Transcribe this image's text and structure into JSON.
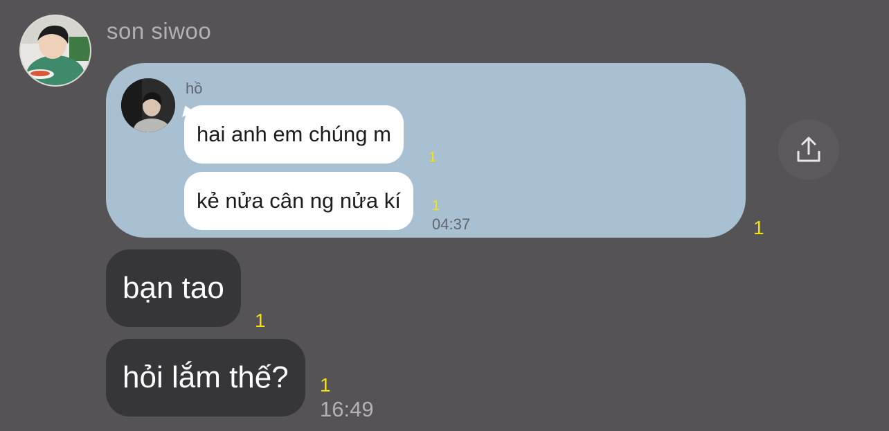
{
  "conversation": {
    "sender_name": "son siwoo",
    "shared_message": {
      "author_name": "hồ",
      "lines": [
        {
          "text": "hai anh em chúng m",
          "unread": "1"
        },
        {
          "text": "kẻ nửa cân ng nửa kí",
          "unread": "1"
        }
      ],
      "time": "04:37",
      "card_unread": "1"
    },
    "messages": [
      {
        "text": "bạn tao",
        "unread": "1"
      },
      {
        "text": "hỏi lắm thế?",
        "unread": "1"
      }
    ],
    "last_time": "16:49"
  },
  "icons": {
    "share": "share-upload-icon"
  },
  "colors": {
    "background": "#555355",
    "card": "#a9bfd2",
    "bubble_dark": "#363538",
    "unread": "#f5e500"
  }
}
